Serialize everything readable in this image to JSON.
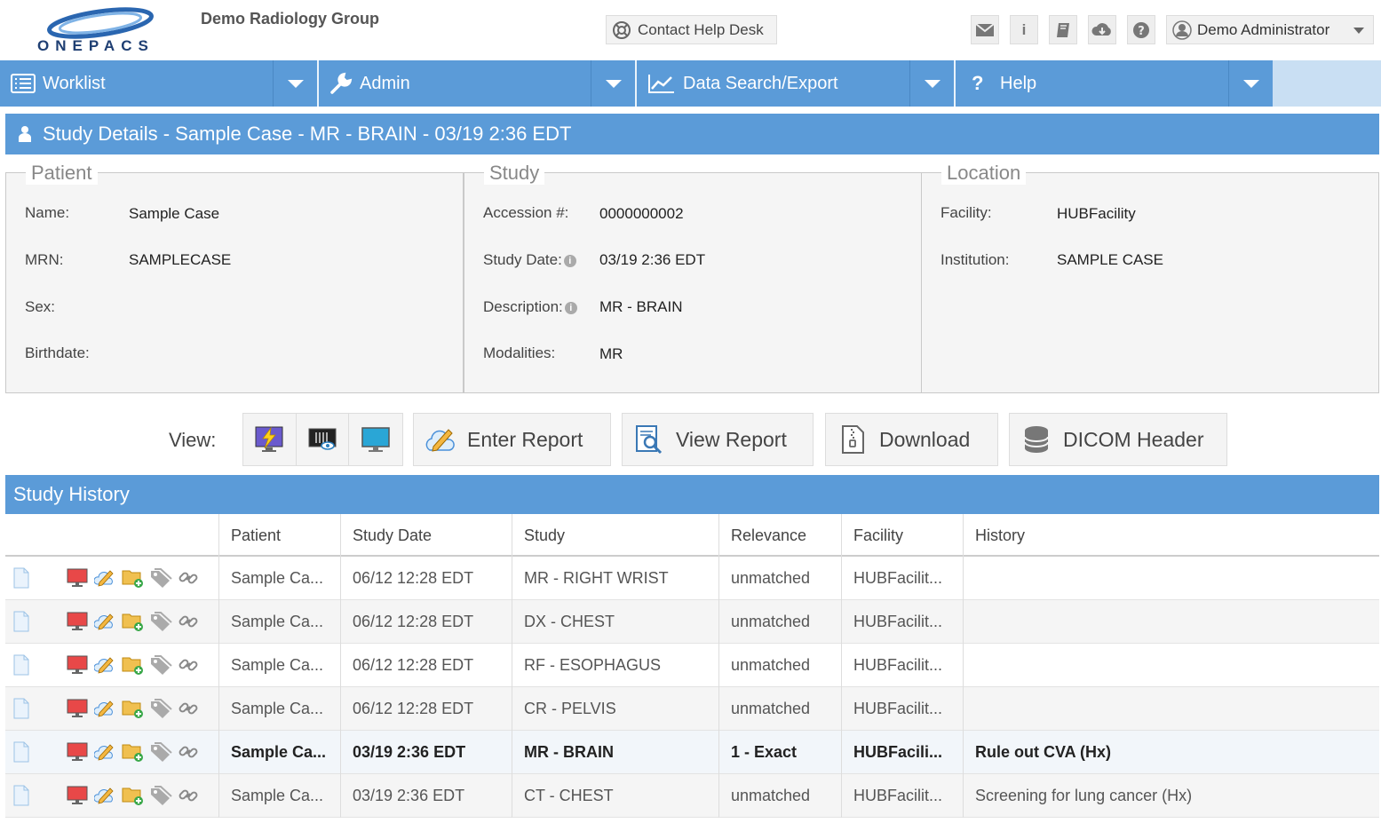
{
  "header": {
    "logo_text": "ONEPACS",
    "group_name": "Demo Radiology Group",
    "help_desk_label": "Contact Help Desk",
    "user_name": "Demo Administrator"
  },
  "nav": [
    {
      "label": "Worklist"
    },
    {
      "label": "Admin"
    },
    {
      "label": "Data Search/Export"
    },
    {
      "label": "Help"
    }
  ],
  "study_details": {
    "title": "Study Details - Sample Case - MR - BRAIN - 03/19 2:36 EDT",
    "patient": {
      "legend": "Patient",
      "name_label": "Name:",
      "name": "Sample Case",
      "mrn_label": "MRN:",
      "mrn": "SAMPLECASE",
      "sex_label": "Sex:",
      "sex": "",
      "birthdate_label": "Birthdate:",
      "birthdate": ""
    },
    "study": {
      "legend": "Study",
      "accession_label": "Accession #:",
      "accession": "0000000002",
      "date_label": "Study Date:",
      "date": "03/19 2:36 EDT",
      "description_label": "Description:",
      "description": "MR - BRAIN",
      "modalities_label": "Modalities:",
      "modalities": "MR"
    },
    "location": {
      "legend": "Location",
      "facility_label": "Facility:",
      "facility": "HUBFacility",
      "institution_label": "Institution:",
      "institution": "SAMPLE CASE"
    }
  },
  "toolbar": {
    "view_label": "View:",
    "enter_report": "Enter Report",
    "view_report": "View Report",
    "download": "Download",
    "dicom_header": "DICOM Header"
  },
  "history": {
    "title": "Study History",
    "columns": [
      "Patient",
      "Study Date",
      "Study",
      "Relevance",
      "Facility",
      "History"
    ],
    "rows": [
      {
        "patient": "Sample Ca...",
        "date": "06/12 12:28 EDT",
        "study": "MR - RIGHT WRIST",
        "relevance": "unmatched",
        "facility": "HUBFacilit...",
        "history": ""
      },
      {
        "patient": "Sample Ca...",
        "date": "06/12 12:28 EDT",
        "study": "DX - CHEST",
        "relevance": "unmatched",
        "facility": "HUBFacilit...",
        "history": ""
      },
      {
        "patient": "Sample Ca...",
        "date": "06/12 12:28 EDT",
        "study": "RF - ESOPHAGUS",
        "relevance": "unmatched",
        "facility": "HUBFacilit...",
        "history": ""
      },
      {
        "patient": "Sample Ca...",
        "date": "06/12 12:28 EDT",
        "study": "CR - PELVIS",
        "relevance": "unmatched",
        "facility": "HUBFacilit...",
        "history": ""
      },
      {
        "patient": "Sample Ca...",
        "date": "03/19 2:36 EDT",
        "study": "MR - BRAIN",
        "relevance": "1 - Exact",
        "facility": "HUBFacili...",
        "history": "Rule out CVA (Hx)"
      },
      {
        "patient": "Sample Ca...",
        "date": "03/19 2:36 EDT",
        "study": "CT - CHEST",
        "relevance": "unmatched",
        "facility": "HUBFacilit...",
        "history": "Screening for lung cancer (Hx)"
      }
    ]
  },
  "colors": {
    "accent_blue": "#5b9bd8",
    "nav_tail": "#c9dff3"
  }
}
